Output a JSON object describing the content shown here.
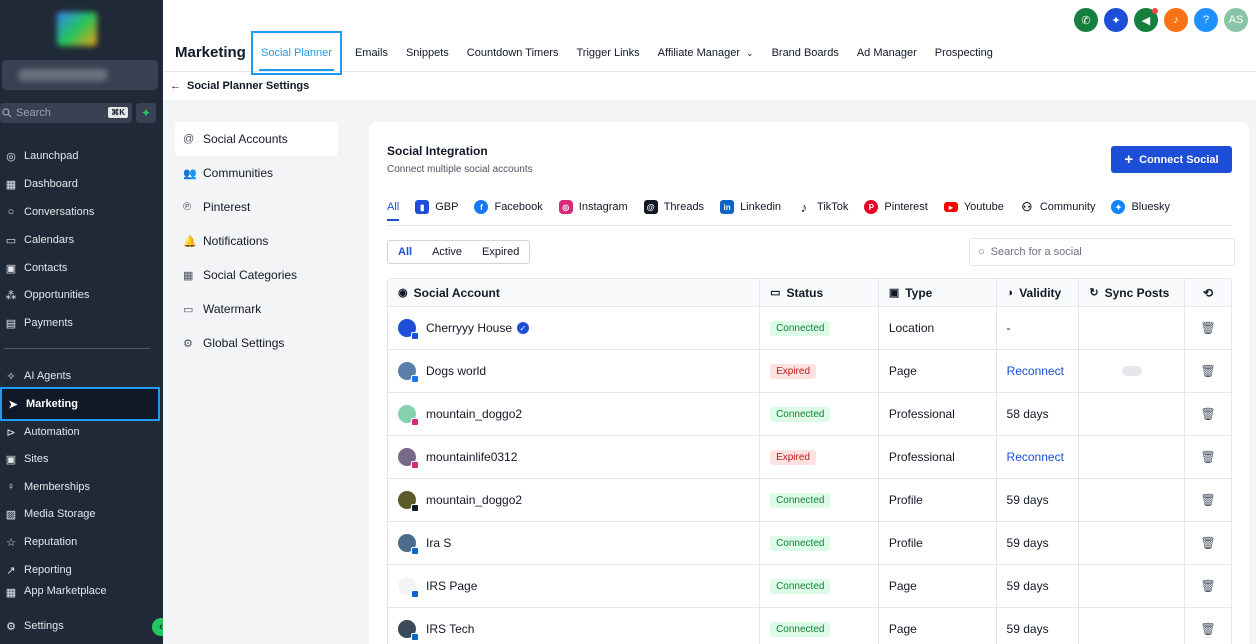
{
  "sidebar": {
    "search_label": "Search",
    "search_shortcut": "⌘K",
    "items": [
      {
        "label": "Launchpad",
        "icon": "launchpad-icon"
      },
      {
        "label": "Dashboard",
        "icon": "dashboard-icon"
      },
      {
        "label": "Conversations",
        "icon": "chat-icon"
      },
      {
        "label": "Calendars",
        "icon": "calendar-icon"
      },
      {
        "label": "Contacts",
        "icon": "contacts-icon"
      },
      {
        "label": "Opportunities",
        "icon": "opportunities-icon"
      },
      {
        "label": "Payments",
        "icon": "payments-icon"
      },
      {
        "label": "AI Agents",
        "icon": "sparkle-icon"
      },
      {
        "label": "Marketing",
        "icon": "send-icon"
      },
      {
        "label": "Automation",
        "icon": "automation-icon"
      },
      {
        "label": "Sites",
        "icon": "sites-icon"
      },
      {
        "label": "Memberships",
        "icon": "memberships-icon"
      },
      {
        "label": "Media Storage",
        "icon": "media-icon"
      },
      {
        "label": "Reputation",
        "icon": "star-icon"
      },
      {
        "label": "Reporting",
        "icon": "chart-icon"
      },
      {
        "label": "App Marketplace",
        "icon": "apps-icon"
      },
      {
        "label": "Settings",
        "icon": "gear-icon"
      }
    ]
  },
  "header": {
    "module_title": "Marketing",
    "tabs": [
      "Social Planner",
      "Emails",
      "Snippets",
      "Countdown Timers",
      "Trigger Links",
      "Affiliate Manager",
      "Brand Boards",
      "Ad Manager",
      "Prospecting"
    ],
    "avatar_initials": "AS",
    "help_label": "?"
  },
  "breadcrumb": {
    "label": "Social Planner Settings"
  },
  "settings_menu": [
    {
      "label": "Social Accounts",
      "icon": "@"
    },
    {
      "label": "Communities",
      "icon": "👥"
    },
    {
      "label": "Pinterest",
      "icon": "℗"
    },
    {
      "label": "Notifications",
      "icon": "🔔"
    },
    {
      "label": "Social Categories",
      "icon": "▦"
    },
    {
      "label": "Watermark",
      "icon": "▭"
    },
    {
      "label": "Global Settings",
      "icon": "⚙"
    }
  ],
  "panel": {
    "title": "Social Integration",
    "subtitle": "Connect multiple social accounts",
    "connect_label": "Connect Social",
    "platforms": [
      "All",
      "GBP",
      "Facebook",
      "Instagram",
      "Threads",
      "Linkedin",
      "TikTok",
      "Pinterest",
      "Youtube",
      "Community",
      "Bluesky"
    ],
    "filters": [
      "All",
      "Active",
      "Expired"
    ],
    "search_placeholder": "Search for a social"
  },
  "table": {
    "headers": [
      "Social Account",
      "Status",
      "Type",
      "Validity",
      "Sync Posts"
    ],
    "rows": [
      {
        "account": "Cherryyy House",
        "status": "Connected",
        "type": "Location",
        "validity": "-"
      },
      {
        "account": "Dogs world",
        "status": "Expired",
        "type": "Page",
        "validity": "Reconnect"
      },
      {
        "account": "mountain_doggo2",
        "status": "Connected",
        "type": "Professional",
        "validity": "58 days"
      },
      {
        "account": "mountainlife0312",
        "status": "Expired",
        "type": "Professional",
        "validity": "Reconnect"
      },
      {
        "account": "mountain_doggo2",
        "status": "Connected",
        "type": "Profile",
        "validity": "59 days"
      },
      {
        "account": "Ira S",
        "status": "Connected",
        "type": "Profile",
        "validity": "59 days"
      },
      {
        "account": "IRS Page",
        "status": "Connected",
        "type": "Page",
        "validity": "59 days"
      },
      {
        "account": "IRS Tech",
        "status": "Connected",
        "type": "Page",
        "validity": "59 days"
      }
    ]
  },
  "colors": {
    "accent": "#1d4ed8",
    "highlight": "#1e9bf0",
    "sidebar_bg": "#1f2937",
    "connected": "#15803d",
    "expired": "#b91c1c"
  }
}
